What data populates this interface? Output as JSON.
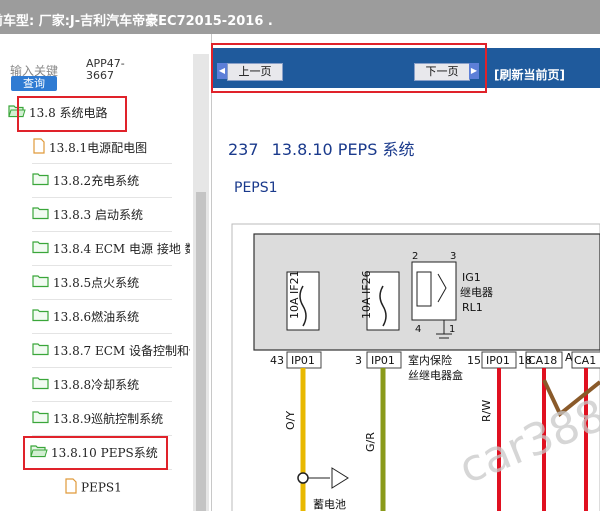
{
  "window": {
    "title": "前车型:  厂家:J-吉利汽车帝豪EC72015-2016   ."
  },
  "search": {
    "label": "输入关键",
    "value": "APP47-3667",
    "button": "查询"
  },
  "tree": {
    "items": [
      {
        "label": "13.8 系统电路",
        "icon": "folder-open-icon"
      },
      {
        "label": "13.8.1电源配电图",
        "icon": "document-icon"
      },
      {
        "label": "13.8.2充电系统",
        "icon": "folder-icon"
      },
      {
        "label": "13.8.3 启动系统",
        "icon": "folder-icon"
      },
      {
        "label": "13.8.4 ECM 电源 接地 数",
        "icon": "folder-icon"
      },
      {
        "label": "13.8.5点火系统",
        "icon": "folder-icon"
      },
      {
        "label": "13.8.6燃油系统",
        "icon": "folder-icon"
      },
      {
        "label": "13.8.7 ECM 设备控制和传",
        "icon": "folder-icon"
      },
      {
        "label": "13.8.8冷却系统",
        "icon": "folder-icon"
      },
      {
        "label": "13.8.9巡航控制系统",
        "icon": "folder-icon"
      },
      {
        "label": "13.8.10 PEPS系统",
        "icon": "folder-open-icon"
      },
      {
        "label": "PEPS1",
        "icon": "document-icon"
      }
    ]
  },
  "nav": {
    "prev": "上一页",
    "next": "下一页",
    "refresh": "[刷新当前页]"
  },
  "page": {
    "number": "237",
    "title": "13.8.10 PEPS 系统",
    "subtitle": "PEPS1"
  },
  "diagram": {
    "fuses": [
      "10A IF21",
      "10A IF26"
    ],
    "relay": {
      "name": "IG1",
      "line2": "继电器",
      "line3": "RL1",
      "pins": [
        "2",
        "3",
        "4",
        "1"
      ]
    },
    "box_label_1": "室内保险",
    "box_label_2": "丝继电器盒",
    "connectors": [
      {
        "pin": "43",
        "name": "IP01"
      },
      {
        "pin": "3",
        "name": "IP01"
      },
      {
        "pin": "15",
        "name": "IP01"
      },
      {
        "pin": "18",
        "name": "CA18"
      },
      {
        "pin": "A",
        "name": "CA1"
      }
    ],
    "wires": [
      "O/Y",
      "G/R",
      "R/W"
    ],
    "battery_label": "蓄电池",
    "watermark": "car388.com"
  },
  "colors": {
    "accent": "#1f5a9c",
    "highlight": "#e0222a",
    "folder": "#3aa63a",
    "wire_orange": "#e8b800",
    "wire_green": "#8a9a1a",
    "wire_red": "#e01020"
  }
}
